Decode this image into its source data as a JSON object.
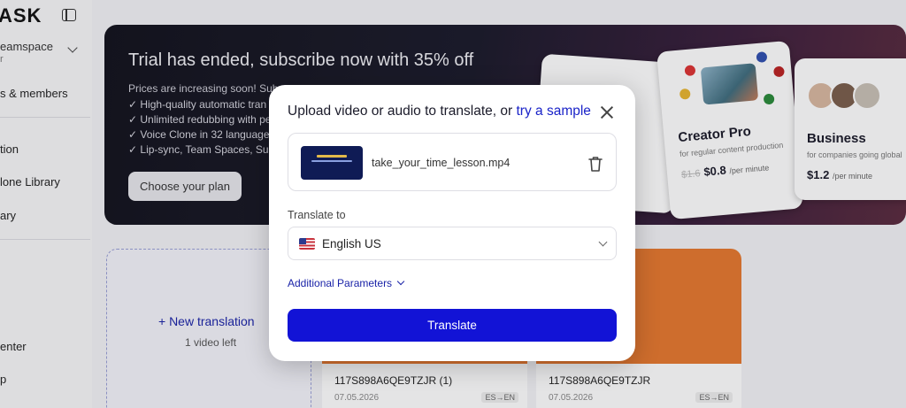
{
  "sidebar": {
    "logo": "ASK",
    "workspace_name": "eamspace",
    "workspace_sub": "r",
    "items": [
      {
        "label": "s & members"
      },
      {
        "label": "tion"
      },
      {
        "label": "lone Library"
      },
      {
        "label": "ary"
      },
      {
        "label": "enter"
      },
      {
        "label": "p"
      }
    ]
  },
  "banner": {
    "title": "Trial has ended, subscribe now with 35% off",
    "subtitle": "Prices are increasing soon! Subs",
    "features": [
      "✓  High-quality automatic tran",
      "✓  Unlimited redubbing with pe",
      "✓  Voice Clone in 32 languages",
      "✓  Lip-sync, Team Spaces, Su"
    ],
    "cta_label": "Choose your plan",
    "plans": [
      {
        "title": "Creator Pro",
        "desc": "for regular content production",
        "old_price": "$1.6",
        "price": "$0.8",
        "unit": "/per minute"
      },
      {
        "title": "Business",
        "desc": "for companies going global",
        "price": "$1.2",
        "unit": "/per minute"
      }
    ]
  },
  "library": {
    "new_translation_label": "+ New translation",
    "videos_left": "1 video left",
    "videos": [
      {
        "name": "117S898A6QE9TZJR (1)",
        "date": "07.05.2026",
        "lang": "ES→EN"
      },
      {
        "name": "117S898A6QE9TZJR",
        "date": "07.05.2026",
        "lang": "ES→EN"
      }
    ]
  },
  "modal": {
    "title_prefix": "Upload video or audio to translate, or ",
    "sample_link": "try a sample",
    "file_name": "take_your_time_lesson.mp4",
    "translate_to_label": "Translate to",
    "selected_language": "English US",
    "additional_params_label": "Additional Parameters",
    "translate_button": "Translate"
  },
  "colors": {
    "accent": "#1213d6",
    "link": "#1a23c8",
    "thumbnail_orange": "#e6782e"
  }
}
